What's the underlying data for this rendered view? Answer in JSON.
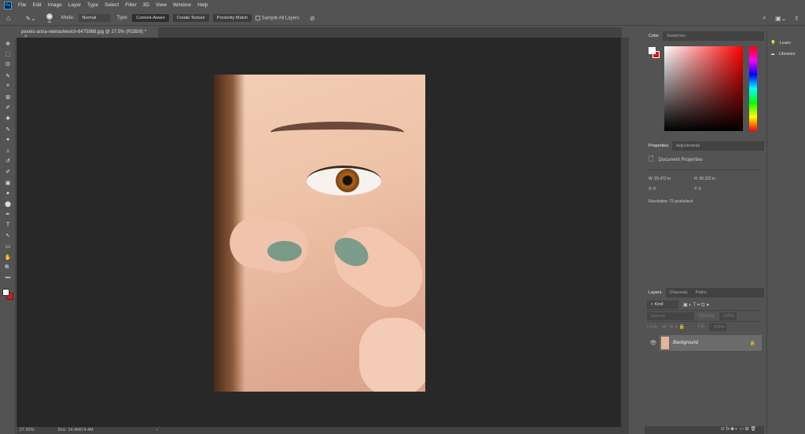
{
  "menubar": {
    "items": [
      "File",
      "Edit",
      "Image",
      "Layer",
      "Type",
      "Select",
      "Filter",
      "3D",
      "View",
      "Window",
      "Help"
    ],
    "logo": "Ps"
  },
  "options": {
    "brush_size": "88",
    "mode_label": "Mode:",
    "mode_value": "Normal",
    "type_label": "Type:",
    "types": [
      "Content-Aware",
      "Create Texture",
      "Proximity Match"
    ],
    "sample_all_layers": "Sample All Layers"
  },
  "document": {
    "tab_title": "pexels-anna-nekrashevich-6475988.jpg @ 27.5% (RGB/8) *",
    "close": "×"
  },
  "status": {
    "zoom": "27.55%",
    "doc": "Doc: 14.4M/14.4M",
    "arrow": "›"
  },
  "color_panel": {
    "tabs": [
      "Color",
      "Swatches"
    ],
    "foreground": "#ffffff",
    "background": "#e8101a",
    "hue": "#ff0000"
  },
  "properties": {
    "tabs": [
      "Properties",
      "Adjustments"
    ],
    "title": "Document Properties",
    "w_label": "W:",
    "w": "25.472 in",
    "h_label": "H:",
    "h": "38.222 in",
    "x_label": "X:",
    "x": "0",
    "y_label": "Y:",
    "y": "0",
    "resolution": "Resolution: 72 pixels/inch"
  },
  "layers": {
    "tabs": [
      "Layers",
      "Channels",
      "Paths"
    ],
    "kind": "Kind",
    "blend": "Normal",
    "opacity_label": "Opacity:",
    "opacity": "100%",
    "lock_label": "Lock:",
    "fill_label": "Fill:",
    "fill": "100%",
    "layer_name": "Background"
  },
  "dock": {
    "learn": "Learn",
    "libraries": "Libraries"
  },
  "tools": [
    "✥",
    "⬚",
    "ʘ",
    "✎",
    "⌗",
    "⊠",
    "✐",
    "✚",
    "✎",
    "✦",
    "⊥",
    "↺",
    "✐",
    "▣",
    "●",
    "⬤",
    "✒",
    "T",
    "↖",
    "▭",
    "✋",
    "🔍",
    "•••"
  ]
}
